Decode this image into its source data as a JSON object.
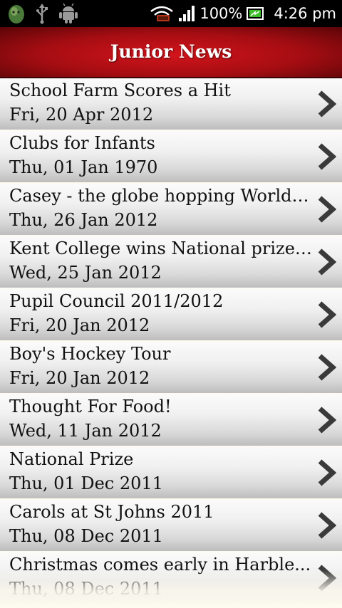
{
  "status_bar": {
    "battery_percent": "100%",
    "time": "4:26 pm",
    "left_icons": [
      "android-debug-icon",
      "usb-icon",
      "android-icon"
    ],
    "right_icons": [
      "wifi-icon",
      "signal-icon",
      "battery-icon"
    ]
  },
  "header": {
    "title": "Junior News",
    "color": "#c4111a"
  },
  "news": [
    {
      "title": "School Farm Scores a Hit",
      "date": "Fri, 20 Apr 2012"
    },
    {
      "title": "Clubs for Infants",
      "date": "Thu, 01 Jan 1970"
    },
    {
      "title": "Casey - the globe hopping World ...",
      "date": "Thu, 26 Jan 2012"
    },
    {
      "title": "Kent College wins National prize ...",
      "date": "Wed, 25 Jan 2012"
    },
    {
      "title": "Pupil Council 2011/2012",
      "date": "Fri, 20 Jan 2012"
    },
    {
      "title": "Boy's Hockey Tour",
      "date": "Fri, 20 Jan 2012"
    },
    {
      "title": "Thought For Food!",
      "date": "Wed, 11 Jan 2012"
    },
    {
      "title": "National Prize",
      "date": "Thu, 01 Dec 2011"
    },
    {
      "title": "Carols at St Johns 2011",
      "date": "Thu, 08 Dec 2011"
    },
    {
      "title": "Christmas comes early in Harble...",
      "date": "Thu, 08 Dec 2011"
    }
  ]
}
